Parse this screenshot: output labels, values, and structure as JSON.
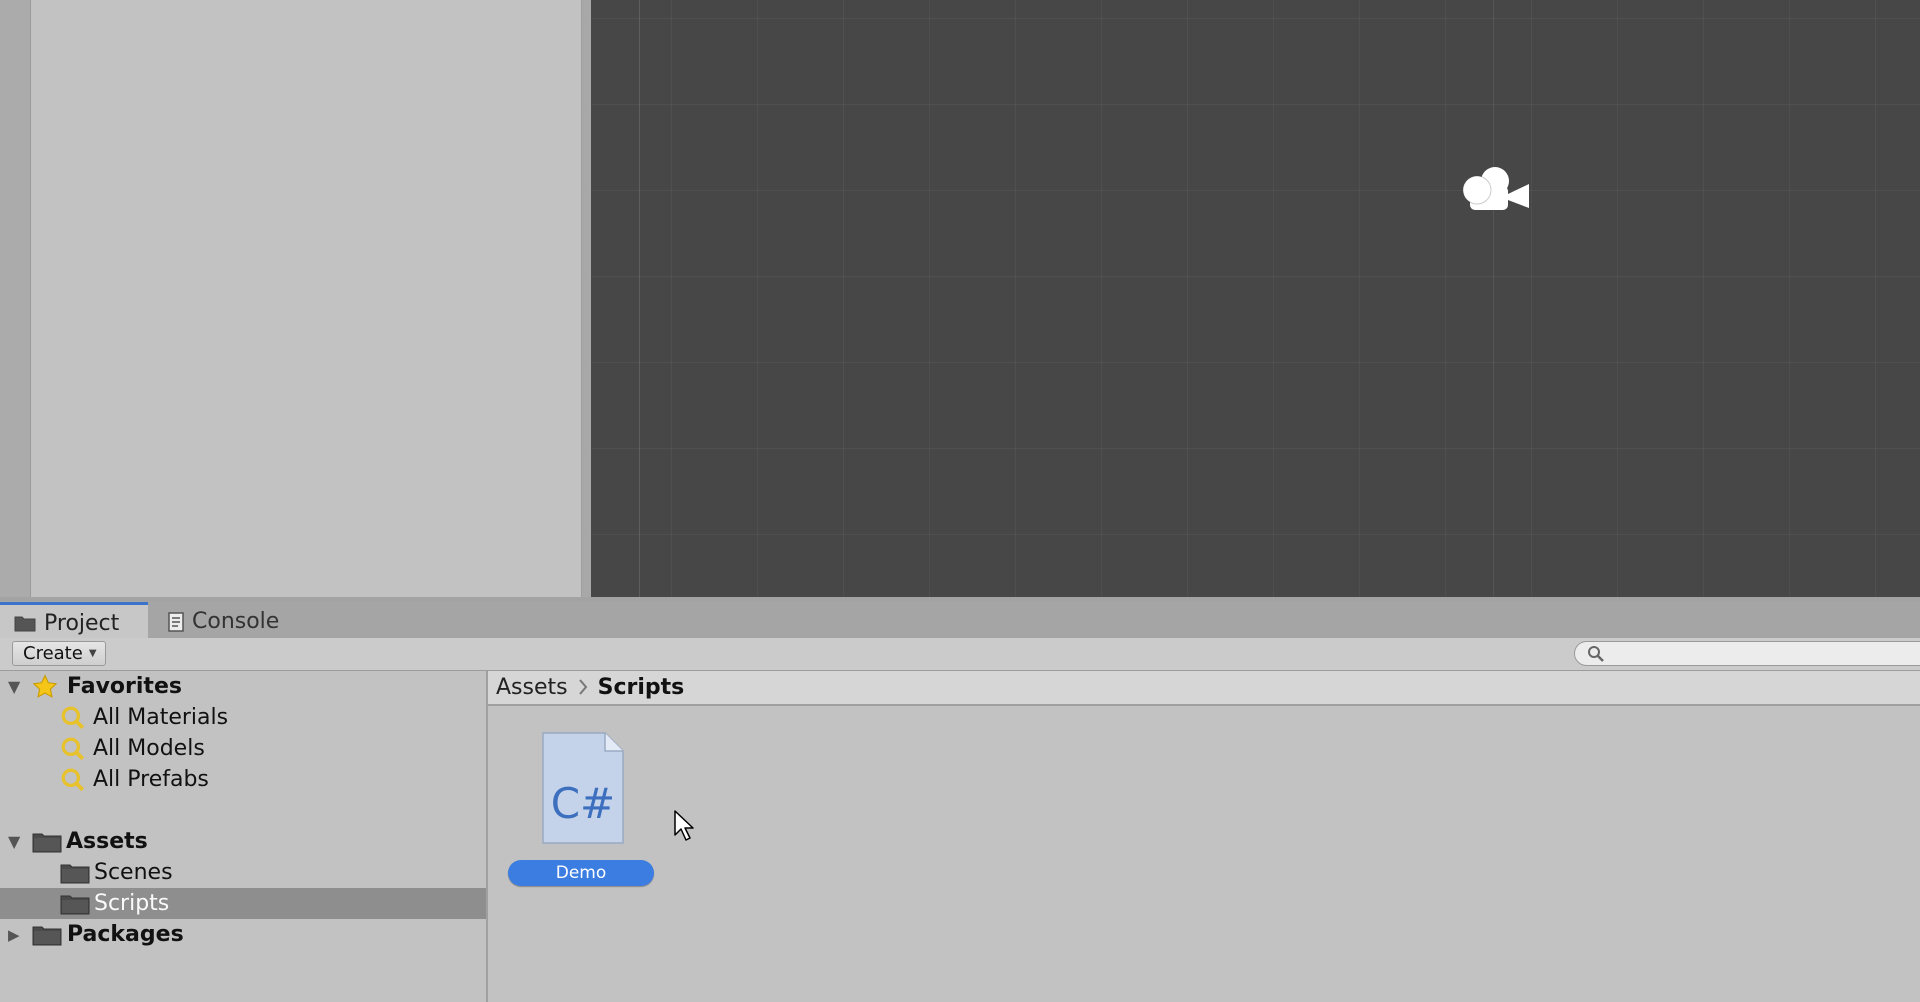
{
  "tabs": [
    {
      "label": "Project",
      "icon": "folder-icon",
      "active": true
    },
    {
      "label": "Console",
      "icon": "console-icon",
      "active": false
    }
  ],
  "toolbar": {
    "create_label": "Create",
    "search_placeholder": ""
  },
  "tree": {
    "favorites": {
      "label": "Favorites",
      "items": [
        "All Materials",
        "All Models",
        "All Prefabs"
      ]
    },
    "assets": {
      "label": "Assets",
      "items": [
        "Scenes",
        "Scripts"
      ],
      "selected": "Scripts"
    },
    "packages": {
      "label": "Packages"
    }
  },
  "breadcrumb": [
    "Assets",
    "Scripts"
  ],
  "files": [
    {
      "name": "Demo",
      "type_glyph": "C#",
      "icon": "csharp-script-icon"
    }
  ],
  "colors": {
    "accent": "#3b7de0",
    "scene_bg": "#474747",
    "panel_bg": "#c2c2c2",
    "selection": "#8e8e8e",
    "favorite_star": "#f5c518",
    "search_icon": "#e8c22a"
  }
}
